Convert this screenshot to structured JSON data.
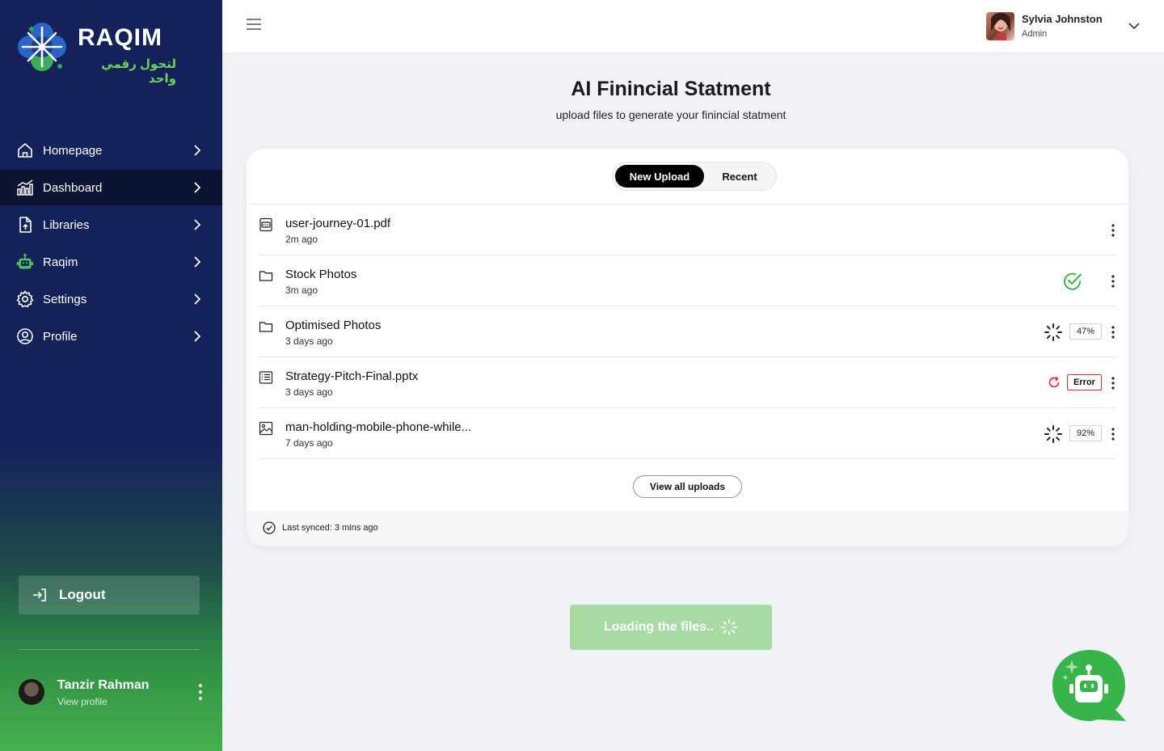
{
  "brand": {
    "name": "RAQIM",
    "tagline": "لتحول رقمي واحد"
  },
  "sidebar": {
    "items": [
      {
        "label": "Homepage",
        "icon": "home-icon"
      },
      {
        "label": "Dashboard",
        "icon": "chart-icon",
        "active": true
      },
      {
        "label": "Libraries",
        "icon": "file-upload-icon"
      },
      {
        "label": "Raqim",
        "icon": "robot-icon"
      },
      {
        "label": "Settings",
        "icon": "gear-icon"
      },
      {
        "label": "Profile",
        "icon": "user-circle-icon"
      }
    ],
    "logout_label": "Logout",
    "user": {
      "name": "Tanzir Rahman",
      "link": "View profile"
    }
  },
  "header": {
    "user_name": "Sylvia Johnston",
    "user_role": "Admin"
  },
  "main": {
    "title": "AI Finincial Statment",
    "subtitle": "upload files to generate your finincial statment",
    "tabs": {
      "new_upload": "New Upload",
      "recent": "Recent"
    },
    "files": [
      {
        "name": "user-journey-01.pdf",
        "time": "2m ago",
        "type": "pdf-icon",
        "status": "none"
      },
      {
        "name": "Stock Photos",
        "time": "3m ago",
        "type": "folder-icon",
        "status": "done"
      },
      {
        "name": "Optimised Photos",
        "time": "3 days ago",
        "type": "folder-icon",
        "status": "uploading",
        "progress": "47%"
      },
      {
        "name": "Strategy-Pitch-Final.pptx",
        "time": "3 days ago",
        "type": "document-icon",
        "status": "error",
        "error_label": "Error"
      },
      {
        "name": "man-holding-mobile-phone-while...",
        "time": "7 days ago",
        "type": "image-icon",
        "status": "uploading",
        "progress": "92%"
      }
    ],
    "view_all": "View all uploads",
    "last_synced": "Last synced: 3 mins ago",
    "loading_label": "Loading the files.."
  },
  "colors": {
    "sidebar_top": "#14215a",
    "sidebar_bottom": "#47b04c",
    "accent_green": "#37b44a",
    "error_red": "#e0263a"
  }
}
